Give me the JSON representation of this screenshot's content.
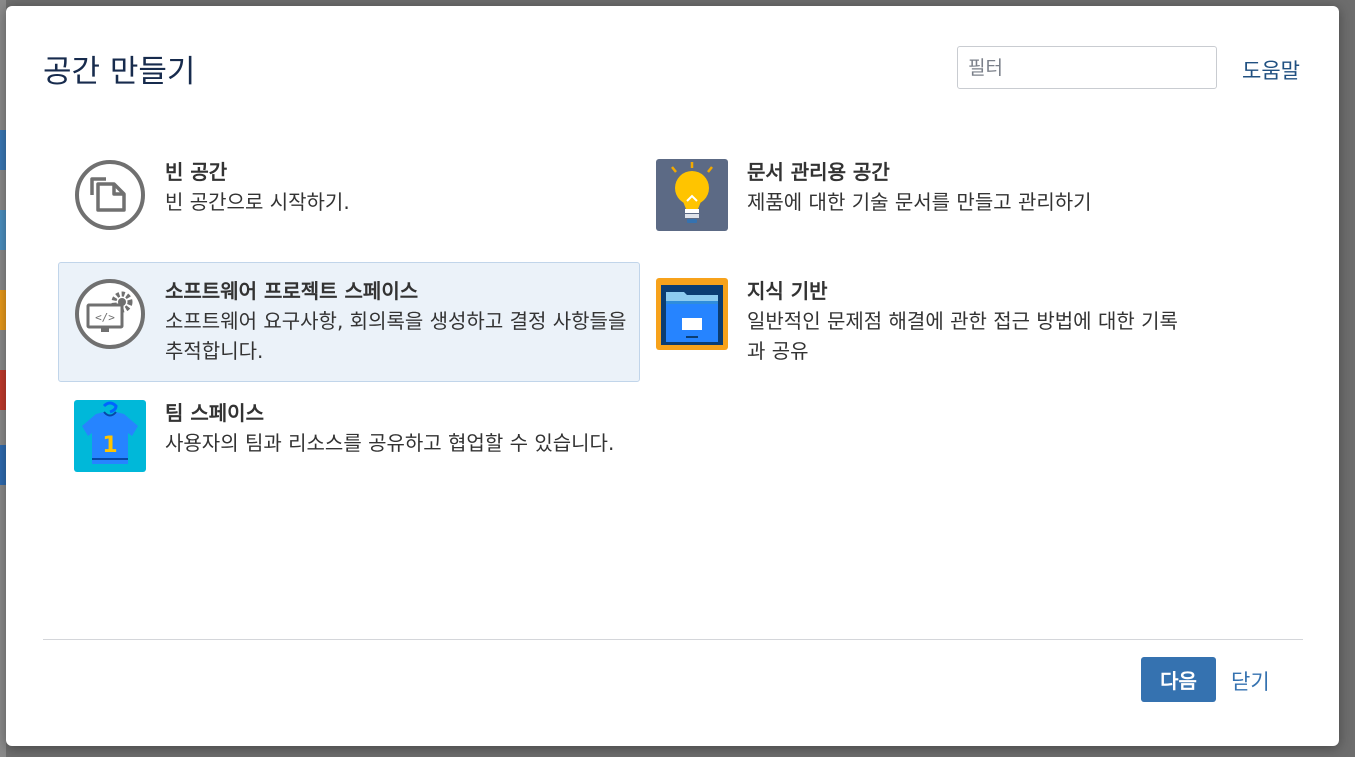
{
  "dialog": {
    "title": "공간 만들기",
    "filter_placeholder": "필터",
    "help_label": "도움말"
  },
  "blueprints": [
    {
      "name": "빈 공간",
      "description": "빈 공간으로 시작하기.",
      "icon": "blank-page-icon"
    },
    {
      "name": "문서 관리용 공간",
      "description": "제품에 대한 기술 문서를 만들고 관리하기",
      "icon": "lightbulb-icon"
    },
    {
      "name": "소프트웨어 프로젝트 스페이스",
      "description": "소프트웨어 요구사항, 회의록을 생성하고 결정 사항들을 추적합니다.",
      "icon": "software-code-gear-icon",
      "selected": true
    },
    {
      "name": "지식 기반",
      "description": "일반적인 문제점 해결에 관한 접근 방법에 대한 기록과 공유",
      "icon": "file-cabinet-icon"
    },
    {
      "name": "팀 스페이스",
      "description": "사용자의 팀과 리소스를 공유하고 협업할 수 있습니다.",
      "icon": "team-jersey-icon"
    }
  ],
  "footer": {
    "next_label": "다음",
    "close_label": "닫기"
  },
  "colors": {
    "primary": "#3572b0",
    "link": "#205081",
    "selected_bg": "#ebf2f9"
  }
}
